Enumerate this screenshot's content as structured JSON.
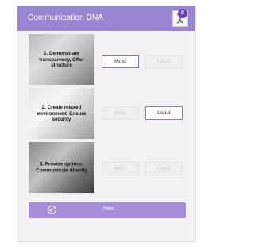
{
  "header": {
    "title": "Communication DNA",
    "badge_count": "0",
    "logo_icon": "dna-icon"
  },
  "rows": [
    {
      "label": "1. Demonstrate transparency, Offer structure",
      "most": "Most",
      "least": "Least",
      "selected": "most"
    },
    {
      "label": "2. Create relaxed environment, Ensure security",
      "most": "Most",
      "least": "Least",
      "selected": "least"
    },
    {
      "label": "3. Provide options, Communicate directly",
      "most": "Most",
      "least": "Least",
      "selected": "none"
    }
  ],
  "footer": {
    "next_label": "Next",
    "next_icon": "check-circle-icon"
  },
  "colors": {
    "accent": "#9b85d3",
    "button": "#a58ddb",
    "selected_border": "#8a76c6"
  }
}
